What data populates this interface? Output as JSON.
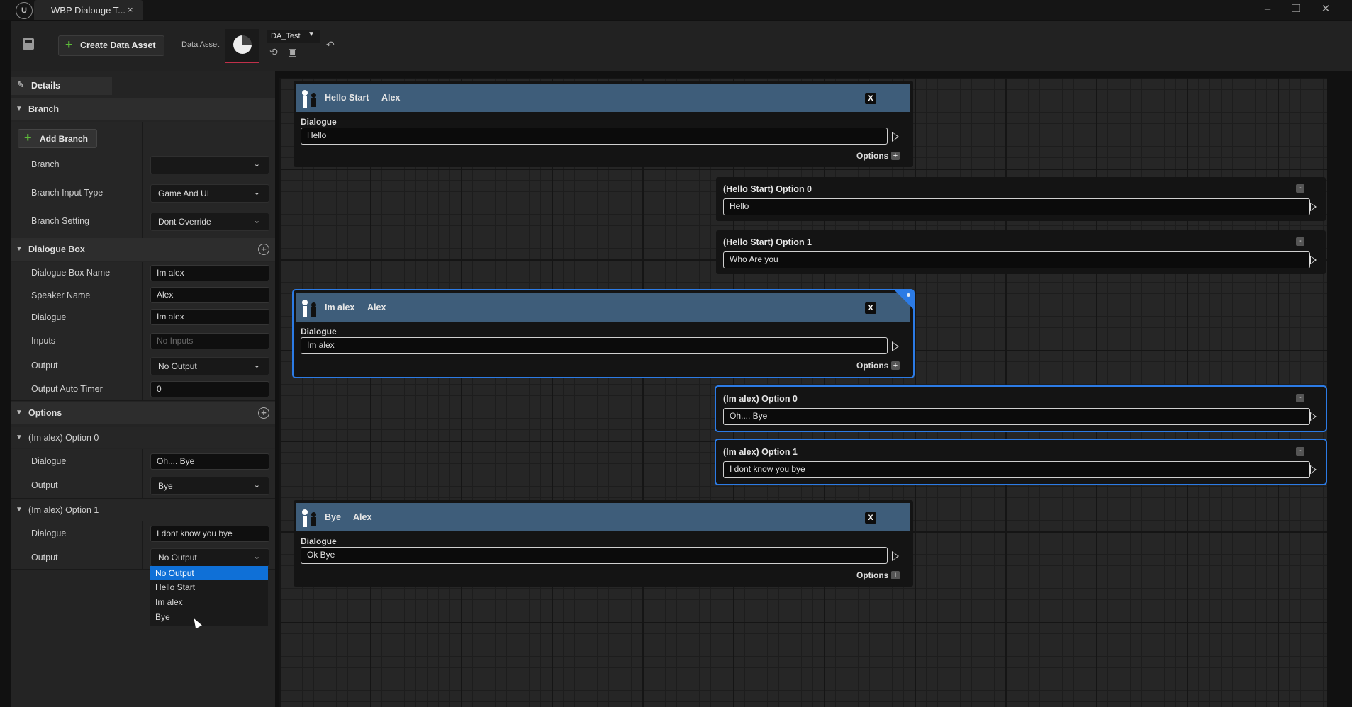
{
  "window": {
    "tab_title": "WBP Dialouge T...",
    "tab_close": "×",
    "logo": "U",
    "controls": [
      "–",
      "❐",
      "✕"
    ]
  },
  "toolbar": {
    "create_label": "Create Data Asset",
    "data_asset_label": "Data Asset",
    "asset_selected": "DA_Test"
  },
  "details": {
    "tab_label": "Details",
    "branch_section": {
      "title": "Branch",
      "add_branch_label": "Add Branch",
      "rows": [
        {
          "label": "Branch",
          "value": ""
        },
        {
          "label": "Branch Input Type",
          "value": "Game And UI"
        },
        {
          "label": "Branch Setting",
          "value": "Dont Override"
        }
      ]
    },
    "dialogue_box_section": {
      "title": "Dialogue Box",
      "rows": [
        {
          "label": "Dialogue Box Name",
          "value": "Im alex"
        },
        {
          "label": "Speaker Name",
          "value": "Alex"
        },
        {
          "label": "Dialogue",
          "value": "Im alex"
        },
        {
          "label": "Inputs",
          "placeholder": "No Inputs"
        },
        {
          "label": "Output",
          "value": "No Output"
        },
        {
          "label": "Output Auto Timer",
          "value": "0"
        }
      ]
    },
    "options_section": {
      "title": "Options",
      "options": [
        {
          "title": "(Im alex) Option 0",
          "dialogue_label": "Dialogue",
          "dialogue": "Oh.... Bye",
          "output_label": "Output",
          "output": "Bye"
        },
        {
          "title": "(Im alex) Option 1",
          "dialogue_label": "Dialogue",
          "dialogue": "I dont know you bye",
          "output_label": "Output",
          "output": "No Output"
        }
      ]
    },
    "output_dropdown": {
      "items": [
        "No Output",
        "Hello Start",
        "Im alex",
        "Bye"
      ],
      "selected": "No Output"
    }
  },
  "graph": {
    "nodes": [
      {
        "title": "Hello Start",
        "speaker": "Alex",
        "close": "X",
        "dialogue_label": "Dialogue",
        "dialogue": "Hello",
        "options_label": "Options",
        "options_plus": "+"
      },
      {
        "title": "Im alex",
        "speaker": "Alex",
        "close": "X",
        "dialogue_label": "Dialogue",
        "dialogue": "Im alex",
        "options_label": "Options",
        "options_plus": "+"
      },
      {
        "title": "Bye",
        "speaker": "Alex",
        "close": "X",
        "dialogue_label": "Dialogue",
        "dialogue": "Ok Bye",
        "options_label": "Options",
        "options_plus": "+"
      }
    ],
    "option_nodes": [
      {
        "title": "(Hello Start) Option 0",
        "text": "Hello",
        "minus": "-"
      },
      {
        "title": "(Hello Start) Option 1",
        "text": "Who Are you",
        "minus": "-"
      },
      {
        "title": "(Im alex) Option 0",
        "text": "Oh.... Bye",
        "minus": "-"
      },
      {
        "title": "(Im alex) Option 1",
        "text": "I dont know you bye",
        "minus": "-"
      }
    ]
  }
}
